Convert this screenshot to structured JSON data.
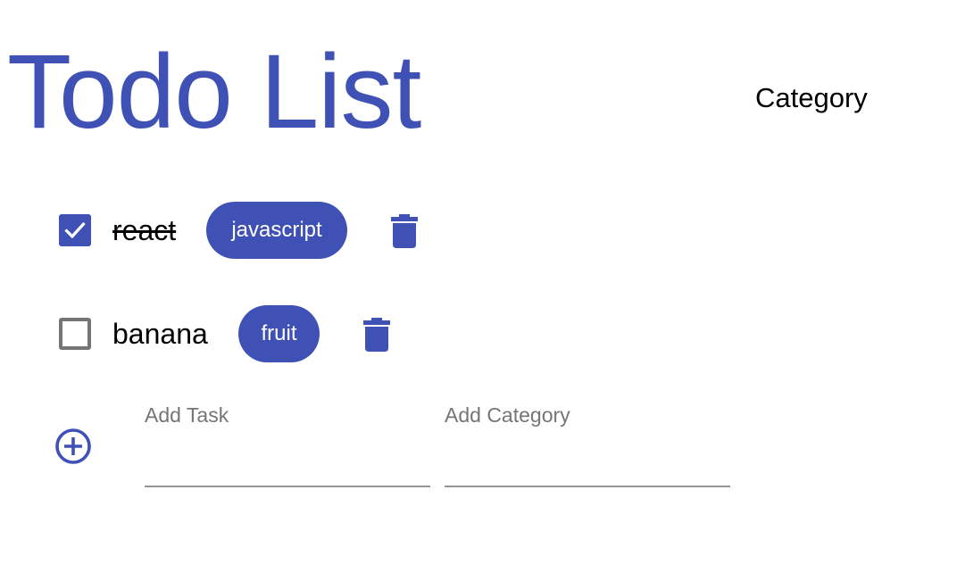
{
  "header": {
    "title": "Todo List",
    "category_link": "Category"
  },
  "todos": [
    {
      "text": "react",
      "category": "javascript",
      "completed": true,
      "delete_icon": "trash-icon"
    },
    {
      "text": "banana",
      "category": "fruit",
      "completed": false,
      "delete_icon": "trash-icon"
    }
  ],
  "add_form": {
    "add_icon": "add-circle-outline-icon",
    "task_label": "Add Task",
    "task_value": "",
    "category_label": "Add Category",
    "category_value": ""
  },
  "colors": {
    "primary": "#3f51b5",
    "unchecked_border": "#757575",
    "label_gray": "#757575",
    "underline": "#949494"
  }
}
